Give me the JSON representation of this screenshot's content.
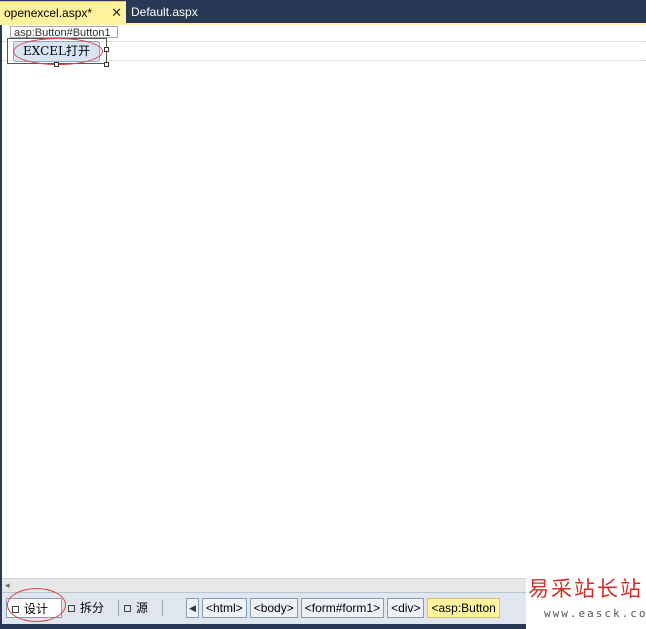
{
  "tabs": [
    {
      "label": "openexcel.aspx*",
      "active": true
    },
    {
      "label": "Default.aspx",
      "active": false
    }
  ],
  "tab_close_glyph": "✕",
  "design": {
    "control_tag": "asp:Button#Button1",
    "button_label": "EXCEL打开"
  },
  "scroll_left_glyph": "◂",
  "views": {
    "design": "设计",
    "split": "拆分",
    "source": "源"
  },
  "breadcrumb_left_glyph": "◀",
  "breadcrumbs": [
    "<html>",
    "<body>",
    "<form#form1>",
    "<div>",
    "<asp:Button"
  ],
  "watermark": {
    "chinese": "易采站长站",
    "url": "www.easck.com"
  },
  "colors": {
    "chrome": "#293955",
    "active_tab": "#FFF29D",
    "annotation": "#E04040",
    "watermark_red": "#D03028"
  }
}
